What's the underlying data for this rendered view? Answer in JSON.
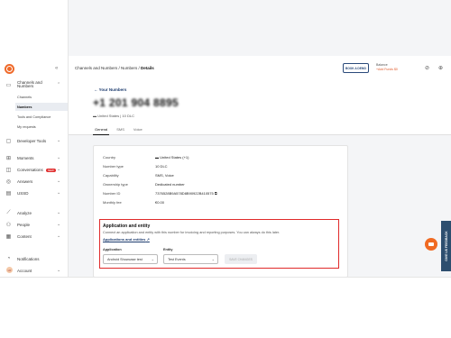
{
  "breadcrumb": {
    "prefix": "Channels and Numbers / Numbers / ",
    "current": "Details"
  },
  "sidebar": {
    "items": [
      {
        "label": "Channels and Numbers",
        "icon": "chat-icon"
      },
      {
        "label": "Developer Tools",
        "icon": "code-icon"
      },
      {
        "label": "Moments",
        "icon": "flow-icon"
      },
      {
        "label": "Conversations",
        "icon": "conversation-icon",
        "badge": "NEW"
      },
      {
        "label": "Answers",
        "icon": "answers-icon"
      },
      {
        "label": "USSD",
        "icon": "ussd-icon"
      },
      {
        "label": "Analyze",
        "icon": "analyze-icon"
      },
      {
        "label": "People",
        "icon": "people-icon"
      },
      {
        "label": "Content",
        "icon": "content-icon"
      },
      {
        "label": "Notifications",
        "icon": "bell-icon"
      },
      {
        "label": "Account",
        "icon": "avatar",
        "initials": "LR"
      }
    ],
    "subitems": [
      "Channels",
      "Numbers",
      "Tools and Compliance",
      "My requests"
    ]
  },
  "topbar": {
    "book_label": "BOOK A DEMO",
    "balance_label": "Balance",
    "balance_link": "+Add Funds $0"
  },
  "number": {
    "back_label": "Your Numbers",
    "phone": "+1 201 904 8895",
    "country": "United States",
    "type": "10 DLC",
    "tabs": [
      "General",
      "SMS",
      "Voice"
    ]
  },
  "details": {
    "rows": [
      {
        "label": "Country",
        "value": "United States (+1)"
      },
      {
        "label": "Number type",
        "value": "10 DLC"
      },
      {
        "label": "Capability",
        "value": "SMS, Voice"
      },
      {
        "label": "Ownership type",
        "value": "Dedicated number"
      },
      {
        "label": "Number ID",
        "value": "7376528B9A578D8B90922B410575"
      },
      {
        "label": "Monthly fee",
        "value": "€0.00"
      }
    ]
  },
  "application": {
    "title": "Application and entity",
    "description": "Connect an application and entity with this number for invoicing and reporting purposes. You can always do this later.",
    "link": "Applications and entities",
    "application_label": "Application",
    "application_value": "Android Showcase test",
    "entity_label": "Entity",
    "entity_value": "Test Events",
    "save_label": "SAVE CHANGES"
  },
  "feedback_label": "GIVE US FEEDBACK",
  "colors": {
    "accent": "#ef6a2a",
    "primary": "#1c3b6e",
    "highlight": "#e02a2a"
  }
}
